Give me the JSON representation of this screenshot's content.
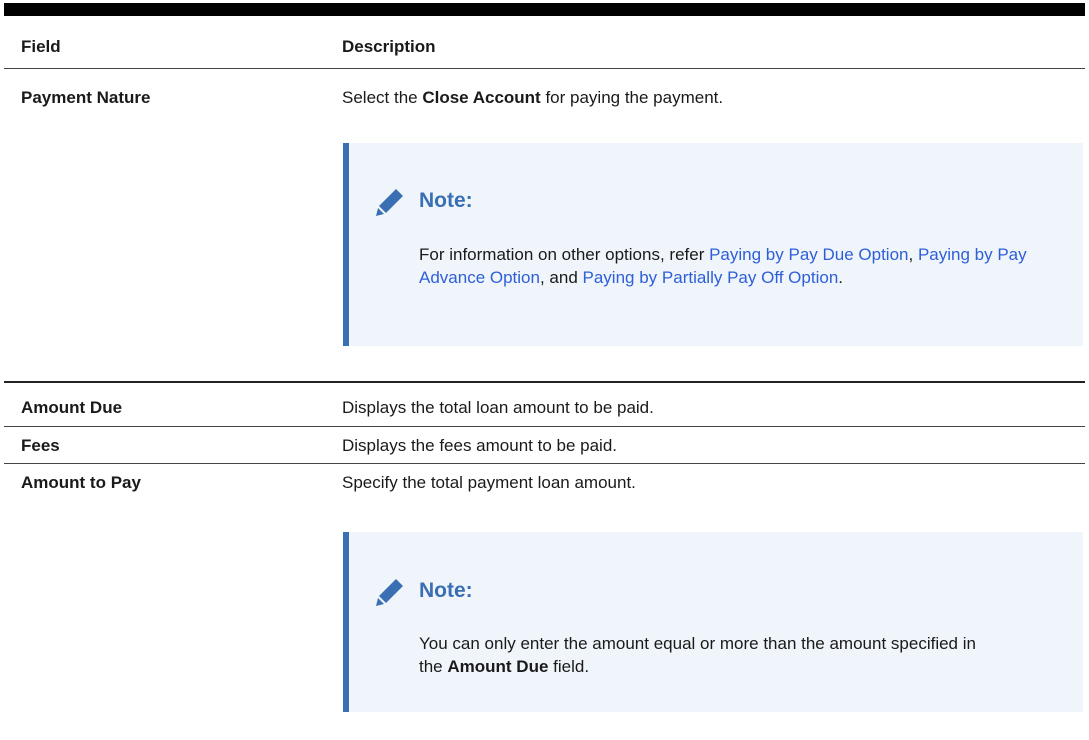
{
  "table": {
    "headers": {
      "field": "Field",
      "description": "Description"
    },
    "rows": [
      {
        "field": "Payment Nature",
        "desc": {
          "pre": "Select the ",
          "bold": "Close Account",
          "post": " for paying the payment."
        },
        "note": {
          "title": "Note:",
          "intro": "For information on other options, refer ",
          "link1": "Paying by Pay Due Option",
          "sep1": ", ",
          "link2": "Paying by Pay Advance Option",
          "sep2": ", and ",
          "link3": "Paying by Partially Pay Off Option",
          "end": "."
        }
      },
      {
        "field": "Amount Due",
        "desc": "Displays the total loan amount to be paid."
      },
      {
        "field": "Fees",
        "desc": "Displays the fees amount to be paid."
      },
      {
        "field": "Amount to Pay",
        "desc": "Specify the total payment loan amount.",
        "note": {
          "title": "Note:",
          "pre": "You can only enter the amount equal or more than the amount specified in the ",
          "bold": "Amount Due",
          "post": " field."
        }
      }
    ]
  },
  "note_icon": "pencil-icon",
  "colors": {
    "note_accent": "#3a6fb3",
    "note_bg": "#f0f5fb",
    "link": "#2e5fd8"
  }
}
